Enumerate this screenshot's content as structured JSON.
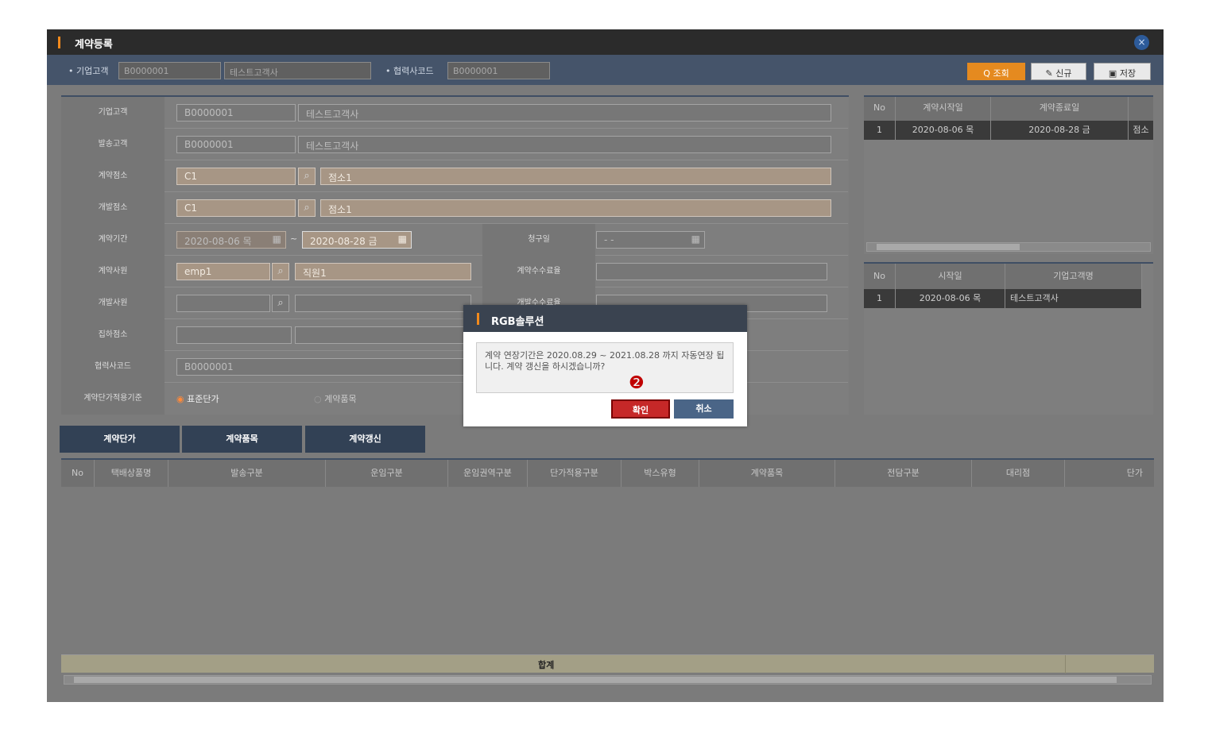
{
  "window": {
    "title": "계약등록",
    "close_label": "×"
  },
  "toolbar": {
    "corp_label": "• 기업고객",
    "corp_code": "B0000001",
    "corp_name": "테스트고객사",
    "partner_label": "• 협력사코드",
    "partner_code": "B0000001",
    "search_label": "Q 조회",
    "new_label": "신규",
    "save_label": "저장",
    "search_color": "#e58a1f"
  },
  "form": {
    "rows": [
      {
        "label": "기업고객",
        "code": "B0000001",
        "name": "테스트고객사"
      },
      {
        "label": "발송고객",
        "code": "B0000001",
        "name": "테스트고객사"
      },
      {
        "label": "계약점소",
        "code": "C1",
        "name": "점소1"
      },
      {
        "label": "개발점소",
        "code": "C1",
        "name": "점소1"
      },
      {
        "label": "계약기간",
        "start": "2020-08-06 목",
        "sep": "~",
        "end": "2020-08-28 금",
        "right_label": "청구일",
        "right_value": "- -"
      },
      {
        "label": "계약사원",
        "code": "emp1",
        "name": "직원1",
        "right_label": "계약수수료율"
      },
      {
        "label": "개발사원",
        "right_label": "개발수수료율"
      },
      {
        "label": "집하점소"
      },
      {
        "label": "협력사코드",
        "code": "B0000001"
      },
      {
        "label": "계약단가적용기준",
        "radio1": "표준단가",
        "radio2": "계약품목"
      }
    ]
  },
  "contract_grid": {
    "headers": [
      "No",
      "계약시작일",
      "계약종료일"
    ],
    "rows": [
      {
        "no": "1",
        "start": "2020-08-06 목",
        "end": "2020-08-28 금",
        "extra": "점소"
      }
    ]
  },
  "renewal_grid": {
    "headers": [
      "No",
      "시작일",
      "기업고객명"
    ],
    "rows": [
      {
        "no": "1",
        "start": "2020-08-06 목",
        "corp": "테스트고객사"
      }
    ]
  },
  "tabs": [
    "계약단가",
    "계약품목",
    "계약갱신"
  ],
  "price_grid": {
    "headers": [
      "No",
      "택배상품명",
      "발송구분",
      "운임구분",
      "운임권역구분",
      "단가적용구분",
      "박스유형",
      "계약품목",
      "전담구분",
      "대리점",
      "단가"
    ],
    "total_label": "합계"
  },
  "dialog": {
    "title": "RGB솔루션",
    "message": "계약 연장기간은 2020.08.29 ~ 2021.08.28 까지 자동연장 됩니다. 계약 갱신을 하시겠습니까?",
    "step_marker": "❷",
    "confirm_label": "확인",
    "cancel_label": "취소",
    "confirm_color": "#c62828",
    "cancel_color": "#4a6587"
  }
}
